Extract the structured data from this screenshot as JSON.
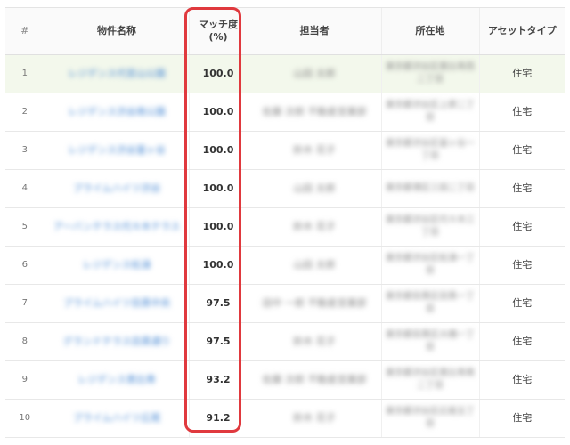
{
  "table": {
    "headers": {
      "num": "#",
      "name": "物件名称",
      "match": "マッチ度\n(%)",
      "owner": "担当者",
      "location": "所在地",
      "asset_type": "アセットタイプ"
    },
    "rows": [
      {
        "num": "1",
        "name": "レジデンス代官山公園",
        "match": "100.0",
        "owner": "山田 太郎",
        "location": "東京都渋谷区恵比寿西二丁目",
        "asset_type": "住宅"
      },
      {
        "num": "2",
        "name": "レジデンス渋谷南公園",
        "match": "100.0",
        "owner": "佐藤 次郎 不動産営業部",
        "location": "東京都渋谷区上原二丁目",
        "asset_type": "住宅"
      },
      {
        "num": "3",
        "name": "レジデンス渋谷富ヶ谷",
        "match": "100.0",
        "owner": "鈴木 花子",
        "location": "東京都渋谷区富ヶ谷一丁目",
        "asset_type": "住宅"
      },
      {
        "num": "4",
        "name": "プライムハイツ渋谷",
        "match": "100.0",
        "owner": "山田 太郎",
        "location": "東京都港区三田二丁目",
        "asset_type": "住宅"
      },
      {
        "num": "5",
        "name": "アーバンテラス代々木テラス",
        "match": "100.0",
        "owner": "鈴木 花子",
        "location": "東京都渋谷区代々木三丁目",
        "asset_type": "住宅"
      },
      {
        "num": "6",
        "name": "レジデンス松濤",
        "match": "100.0",
        "owner": "山田 太郎",
        "location": "東京都渋谷区松濤一丁目",
        "asset_type": "住宅"
      },
      {
        "num": "7",
        "name": "プライムハイツ目黒中央",
        "match": "97.5",
        "owner": "田中 一郎 不動産営業部",
        "location": "東京都目黒区目黒一丁目",
        "asset_type": "住宅"
      },
      {
        "num": "8",
        "name": "グランドテラス目黒通り",
        "match": "97.5",
        "owner": "鈴木 花子",
        "location": "東京都目黒区大橋一丁目",
        "asset_type": "住宅"
      },
      {
        "num": "9",
        "name": "レジデンス恵比寿",
        "match": "93.2",
        "owner": "佐藤 次郎 不動産営業部",
        "location": "東京都渋谷区恵比寿南二丁目",
        "asset_type": "住宅"
      },
      {
        "num": "10",
        "name": "プライムハイツ広尾",
        "match": "91.2",
        "owner": "鈴木 花子",
        "location": "東京都渋谷区広尾五丁目",
        "asset_type": "住宅"
      }
    ]
  },
  "colors": {
    "highlight_outline": "#e0393e",
    "link": "#4a8ad4",
    "first_row_bg": "#f3f8ec"
  }
}
